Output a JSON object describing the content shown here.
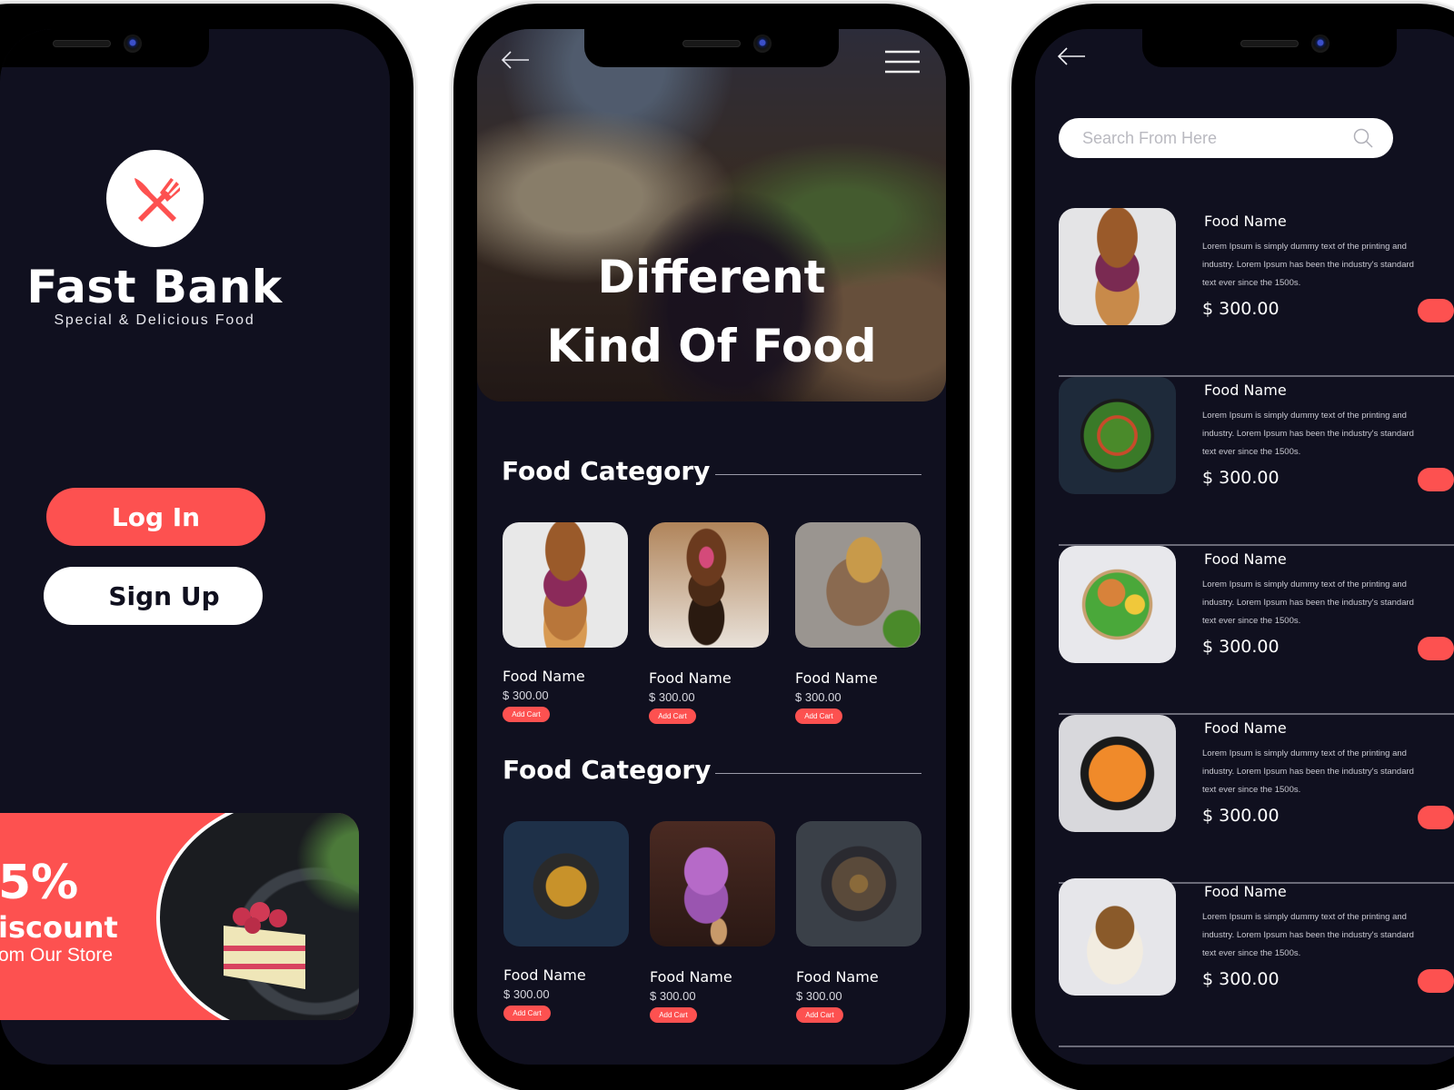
{
  "theme": {
    "background": "#10101f",
    "accent": "#fd5150",
    "text": "#ffffff"
  },
  "welcome": {
    "logo_icon": "fork-knife-icon",
    "brand_name": "Fast Bank",
    "tagline": "Special & Delicious Food",
    "login_label": "Log In",
    "signup_label": "Sign Up",
    "promo": {
      "percent": "5%",
      "title": "iscount",
      "subtitle": "om Our Store",
      "image": "raspberry-cake"
    }
  },
  "home": {
    "back_icon": "arrow-left-icon",
    "menu_icon": "hamburger-menu-icon",
    "hero_line1": "Different",
    "hero_line2": "Kind Of Food",
    "sections": [
      {
        "title": "Food Category",
        "items": [
          {
            "name": "Food Name",
            "price": "$ 300.00",
            "button": "Add Cart",
            "image": "burger"
          },
          {
            "name": "Food Name",
            "price": "$ 300.00",
            "button": "Add Cart",
            "image": "donuts"
          },
          {
            "name": "Food Name",
            "price": "$ 300.00",
            "button": "Add Cart",
            "image": "grilled-meat"
          }
        ]
      },
      {
        "title": "Food Category",
        "items": [
          {
            "name": "Food Name",
            "price": "$ 300.00",
            "button": "Add Cart",
            "image": "oatmeal-bowl"
          },
          {
            "name": "Food Name",
            "price": "$ 300.00",
            "button": "Add Cart",
            "image": "ice-cream-bars"
          },
          {
            "name": "Food Name",
            "price": "$ 300.00",
            "button": "Add Cart",
            "image": "platter"
          }
        ]
      }
    ]
  },
  "list": {
    "back_icon": "arrow-left-icon",
    "search_placeholder": "Search From Here",
    "items": [
      {
        "name": "Food Name",
        "desc1": "Lorem Ipsum is simply dummy text of the printing and",
        "desc2": "industry. Lorem Ipsum has been the industry's standard",
        "desc3": "text ever since the 1500s.",
        "price": "$ 300.00",
        "image": "burger"
      },
      {
        "name": "Food Name",
        "desc1": "Lorem Ipsum is simply dummy text of the printing and",
        "desc2": "industry. Lorem Ipsum has been the industry's standard",
        "desc3": "text ever since the 1500s.",
        "price": "$ 300.00",
        "image": "salad"
      },
      {
        "name": "Food Name",
        "desc1": "Lorem Ipsum is simply dummy text of the printing and",
        "desc2": "industry. Lorem Ipsum has been the industry's standard",
        "desc3": "text ever since the 1500s.",
        "price": "$ 300.00",
        "image": "poke-bowl"
      },
      {
        "name": "Food Name",
        "desc1": "Lorem Ipsum is simply dummy text of the printing and",
        "desc2": "industry. Lorem Ipsum has been the industry's standard",
        "desc3": "text ever since the 1500s.",
        "price": "$ 300.00",
        "image": "salmon-curry"
      },
      {
        "name": "Food Name",
        "desc1": "Lorem Ipsum is simply dummy text of the printing and",
        "desc2": "industry. Lorem Ipsum has been the industry's standard",
        "desc3": "text ever since the 1500s.",
        "price": "$ 300.00",
        "image": "blueberry-cake"
      }
    ]
  }
}
